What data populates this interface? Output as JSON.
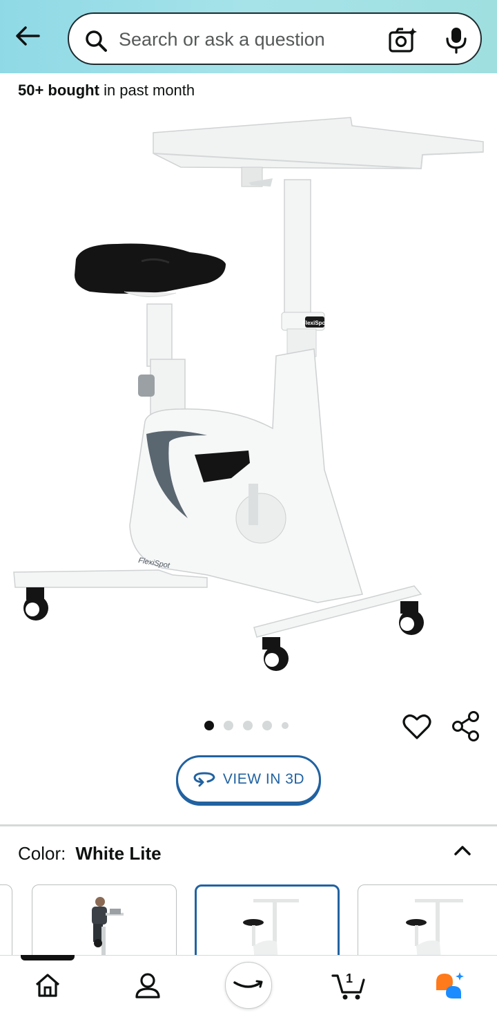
{
  "header": {
    "search_placeholder": "Search or ask a question"
  },
  "social_proof": {
    "bold": "50+ bought",
    "rest": " in past month"
  },
  "product": {
    "brand_label": "FlexiSpot",
    "image_count": 5,
    "active_image": 1
  },
  "actions": {
    "view3d_label": "VIEW IN 3D"
  },
  "variation": {
    "label": "Color:",
    "selected_value": "White Lite"
  },
  "bottom_nav": {
    "items": [
      "home-icon",
      "account-icon",
      "amazon-smile-icon",
      "cart-icon",
      "rufus-ai-icon"
    ],
    "cart_count": "1"
  },
  "colors": {
    "accent_blue": "#2162a1",
    "header_gradient": "#a6e3e9",
    "rufus_orange": "#ff7a1a",
    "rufus_blue": "#1a8cff"
  }
}
